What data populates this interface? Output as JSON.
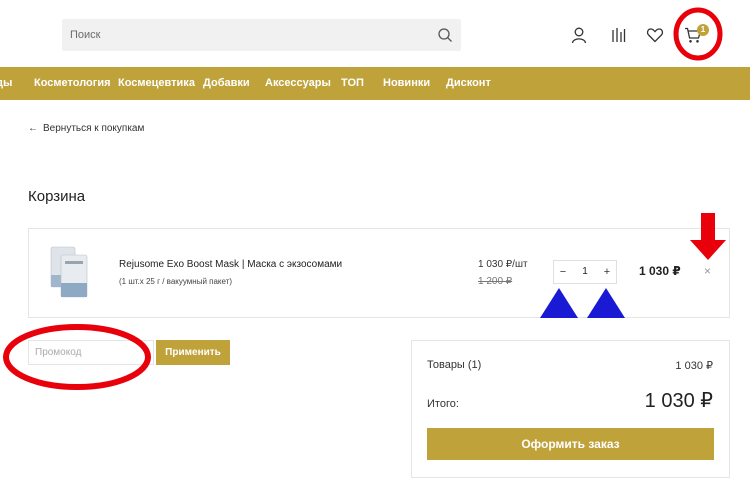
{
  "header": {
    "search_placeholder": "Поиск",
    "icons": [
      "search-icon",
      "user-icon",
      "compare-icon",
      "heart-icon",
      "cart-icon"
    ],
    "cart_count": "1"
  },
  "nav": {
    "items": [
      "ды",
      "Косметология",
      "Космецевтика",
      "Добавки",
      "Аксессуары",
      "ТОП",
      "Новинки",
      "Дисконт"
    ]
  },
  "back_link": "Вернуться к покупкам",
  "page_title": "Корзина",
  "cart_item": {
    "name": "Rejusome Exo Boost Mask | Маска с экзосомами",
    "variant": "(1 шт.x 25 г / вакуумный пакет)",
    "unit_price": "1 030 ₽/шт",
    "old_price": "1 200 ₽",
    "minus": "−",
    "quantity": "1",
    "plus": "+",
    "total": "1 030 ₽",
    "remove": "×"
  },
  "promo": {
    "placeholder": "Промокод",
    "apply_label": "Применить"
  },
  "summary": {
    "items_label": "Товары (1)",
    "items_value": "1 030 ₽",
    "total_label": "Итого:",
    "total_value": "1 030 ₽",
    "checkout_label": "Оформить заказ"
  },
  "colors": {
    "accent": "#c0a23b",
    "annotation_red": "#e8000b",
    "annotation_blue": "#1a1ad4"
  }
}
